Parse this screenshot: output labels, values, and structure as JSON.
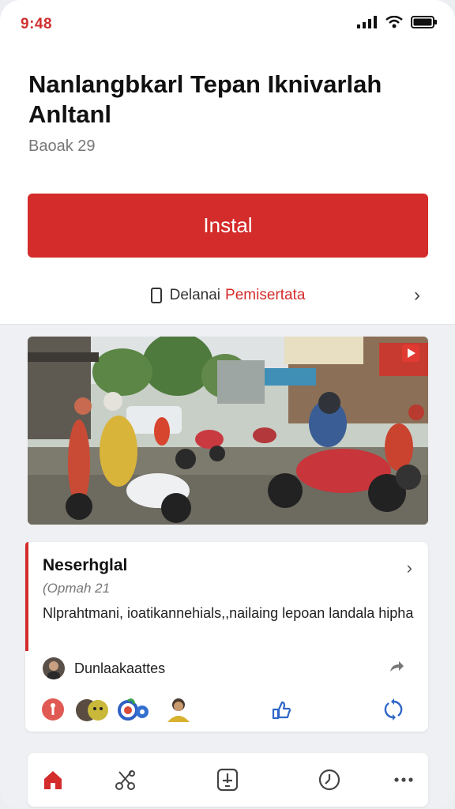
{
  "status": {
    "time": "9:48"
  },
  "app": {
    "title": "Nanlangbkarl Tepan Iknivarlah Anltanl",
    "subtitle": "Baoak 29",
    "install_label": "Instal",
    "details_prefix": "Delanai",
    "details_link": "Pemisertata"
  },
  "card": {
    "title": "Neserhglal",
    "date": "(Opmah 21",
    "body": "Nlprahtmani, ioatikannehials,,nailaing lepoan landala hipha",
    "author": "Dunlaakaattes"
  },
  "colors": {
    "accent": "#d42b2b",
    "time": "#d0302f"
  },
  "icons": {
    "nav": [
      "home-icon",
      "scissors-icon",
      "download-box-icon",
      "clock-icon",
      "more-icon"
    ]
  }
}
